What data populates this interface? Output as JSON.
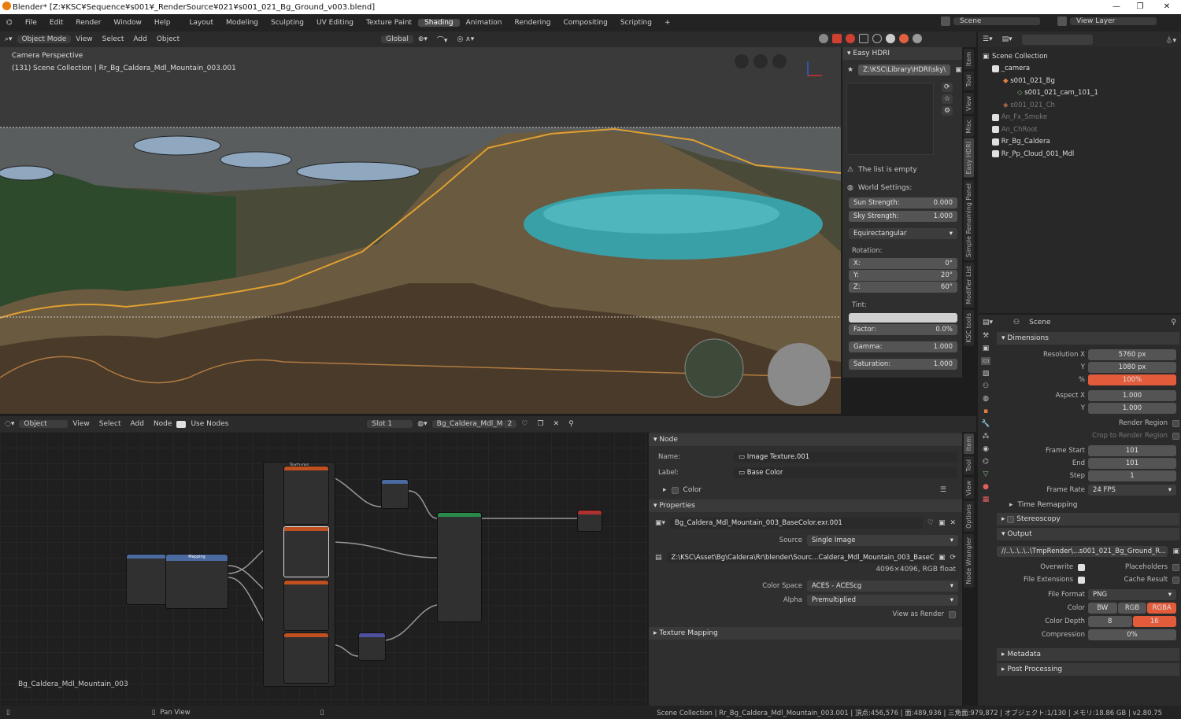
{
  "window": {
    "title": "Blender* [Z:¥KSC¥Sequence¥s001¥_RenderSource¥021¥s001_021_Bg_Ground_v003.blend]",
    "minimize": "—",
    "maximize": "❐",
    "close": "✕"
  },
  "menu": {
    "items": [
      "File",
      "Edit",
      "Render",
      "Window",
      "Help"
    ]
  },
  "workspaces": [
    "Layout",
    "Modeling",
    "Sculpting",
    "UV Editing",
    "Texture Paint",
    "Shading",
    "Animation",
    "Rendering",
    "Compositing",
    "Scripting"
  ],
  "active_workspace": "Shading",
  "scene": {
    "label": "Scene",
    "view_layer": "View Layer"
  },
  "viewport": {
    "mode": "Object Mode",
    "menus": [
      "View",
      "Select",
      "Add",
      "Object"
    ],
    "transform": "Global",
    "overlay_title": "Camera Perspective",
    "overlay_sub": "(131) Scene Collection | Rr_Bg_Caldera_Mdl_Mountain_003.001"
  },
  "hdri": {
    "title": "Easy HDRI",
    "path": "Z:\\KSC\\Library\\HDRI\\sky\\",
    "empty": "The list is empty",
    "world_settings": "World Settings:",
    "sun_label": "Sun Strength:",
    "sun_value": "0.000",
    "sky_label": "Sky Strength:",
    "sky_value": "1.000",
    "mapping": "Equirectangular",
    "rotation": "Rotation:",
    "rx": "X:",
    "rx_v": "0°",
    "ry": "Y:",
    "ry_v": "20°",
    "rz": "Z:",
    "rz_v": "60°",
    "tint": "Tint:",
    "factor": "Factor:",
    "factor_v": "0.0%",
    "gamma": "Gamma:",
    "gamma_v": "1.000",
    "saturation": "Saturation:",
    "saturation_v": "1.000"
  },
  "sidetabs_top": [
    "Item",
    "Tool",
    "View",
    "Misc",
    "Easy HDRI",
    "Simple Renaming Panel",
    "Modifier List",
    "KSC tools"
  ],
  "outliner": {
    "root": "Scene Collection",
    "items": [
      {
        "name": "_camera",
        "indent": 1
      },
      {
        "name": "s001_021_Bg",
        "indent": 2
      },
      {
        "name": "s001_021_cam_101_1",
        "indent": 3
      },
      {
        "name": "s001_021_Ch",
        "indent": 2
      },
      {
        "name": "An_Fx_Smoke",
        "indent": 1
      },
      {
        "name": "An_ChRoot",
        "indent": 1
      },
      {
        "name": "Rr_Bg_Caldera",
        "indent": 1
      },
      {
        "name": "Rr_Pp_Cloud_001_Mdl",
        "indent": 1
      }
    ]
  },
  "props": {
    "scene": "Scene",
    "dimensions": "Dimensions",
    "resx_l": "Resolution X",
    "resx": "5760 px",
    "resy_l": "Y",
    "resy": "1080 px",
    "pct_l": "%",
    "pct": "100%",
    "aspx_l": "Aspect X",
    "aspx": "1.000",
    "aspy_l": "Y",
    "aspy": "1.000",
    "render_region": "Render Region",
    "crop": "Crop to Render Region",
    "fs_l": "Frame Start",
    "fs": "101",
    "fe_l": "End",
    "fe": "101",
    "step_l": "Step",
    "step": "1",
    "fr_l": "Frame Rate",
    "fr": "24 FPS",
    "time_remap": "Time Remapping",
    "stereo": "Stereoscopy",
    "output": "Output",
    "out_path": "//..\\..\\..\\..\\TmpRender\\...s001_021_Bg_Ground_R...",
    "overwrite": "Overwrite",
    "placeholders": "Placeholders",
    "file_ext": "File Extensions",
    "cache_result": "Cache Result",
    "ff_l": "File Format",
    "ff": "PNG",
    "color_l": "Color",
    "bw": "BW",
    "rgb": "RGB",
    "rgba": "RGBA",
    "cd_l": "Color Depth",
    "cd8": "8",
    "cd16": "16",
    "comp_l": "Compression",
    "comp": "0%",
    "metadata": "Metadata",
    "post": "Post Processing"
  },
  "node_editor": {
    "type": "Object",
    "menus": [
      "View",
      "Select",
      "Add",
      "Node"
    ],
    "use_nodes": "Use Nodes",
    "slot": "Slot 1",
    "material": "Bg_Caldera_Mdl_Mo...",
    "users": "2",
    "footer": "Bg_Caldera_Mdl_Mountain_003",
    "frame_label": "Textures",
    "mapping_label": "Mapping"
  },
  "node_panel": {
    "node": "Node",
    "name_l": "Name:",
    "name": "Image Texture.001",
    "label_l": "Label:",
    "label": "Base Color",
    "color": "Color",
    "properties": "Properties",
    "image": "Bg_Caldera_Mdl_Mountain_003_BaseColor.exr.001",
    "source_l": "Source",
    "source": "Single Image",
    "filepath": "Z:\\KSC\\Asset\\Bg\\Caldera\\Rr\\blender\\Sourc...Caldera_Mdl_Mountain_003_BaseColor.exr",
    "imginfo": "4096×4096,   RGB float",
    "cs_l": "Color Space",
    "cs": "ACES - ACEScg",
    "alpha_l": "Alpha",
    "alpha": "Premultiplied",
    "var_l": "View as Render",
    "texmap": "Texture Mapping"
  },
  "sidetabs_node": [
    "Item",
    "Tool",
    "View",
    "Options",
    "Node Wrangler"
  ],
  "status": {
    "left": "Pan View",
    "right": "Scene Collection | Rr_Bg_Caldera_Mdl_Mountain_003.001 | 頂点:456,576 | 面:489,936 | 三角面:979,872 | オブジェクト:1/130 | メモリ:18.86 GB | v2.80.75"
  },
  "colors": {
    "accent": "#e06040",
    "sky": "#5c5f60",
    "lake": "#3aa0a8",
    "active_field": "#e25b3a"
  }
}
